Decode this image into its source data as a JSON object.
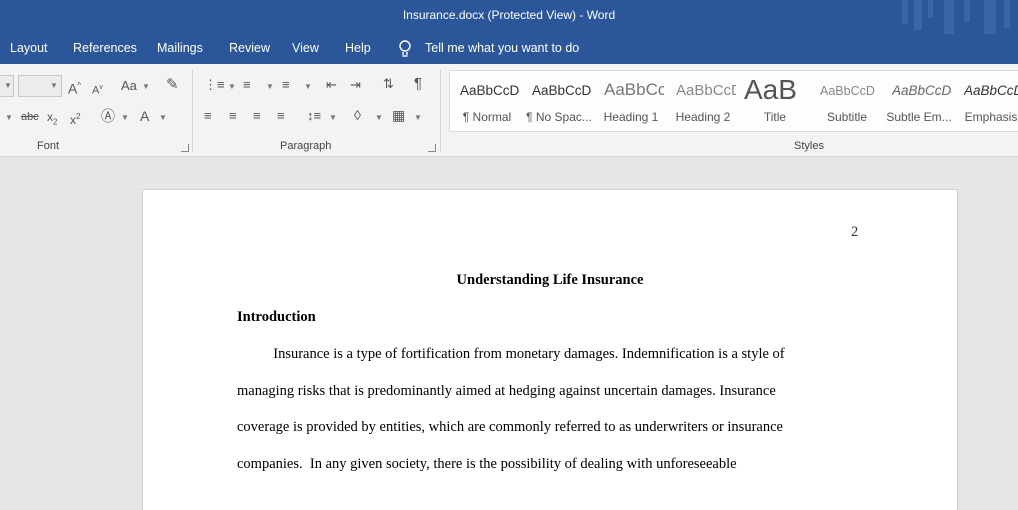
{
  "window": {
    "title": "Insurance.docx (Protected View)  -  Word"
  },
  "menu": {
    "items": [
      "Layout",
      "References",
      "Mailings",
      "Review",
      "View",
      "Help"
    ],
    "tell_me": "Tell me what you want to do"
  },
  "ribbon": {
    "groups": {
      "font": "Font",
      "paragraph": "Paragraph",
      "styles": "Styles"
    },
    "font_case": "Aa",
    "styles": [
      {
        "sample": "AaBbCcDc",
        "name": "¶ Normal"
      },
      {
        "sample": "AaBbCcDc",
        "name": "¶ No Spac..."
      },
      {
        "sample": "AaBbCc",
        "name": "Heading 1"
      },
      {
        "sample": "AaBbCcD",
        "name": "Heading 2"
      },
      {
        "sample": "AaB",
        "name": "Title"
      },
      {
        "sample": "AaBbCcD",
        "name": "Subtitle"
      },
      {
        "sample": "AaBbCcDc",
        "name": "Subtle Em..."
      },
      {
        "sample": "AaBbCcDc",
        "name": "Emphasis"
      }
    ],
    "colors": {
      "title_bar": "#2b579a",
      "ribbon_bg": "#f3f3f3"
    }
  },
  "document": {
    "page_number": "2",
    "title": "Understanding Life Insurance",
    "heading": "Introduction",
    "lines": [
      "          Insurance is a type of fortification from monetary damages. Indemnification is a style of",
      "managing risks that is predominantly aimed at hedging against uncertain damages. Insurance",
      "coverage is provided by entities, which are commonly referred to as underwriters or insurance",
      "companies.  In any given society, there is the possibility of dealing with unforeseeable"
    ]
  }
}
